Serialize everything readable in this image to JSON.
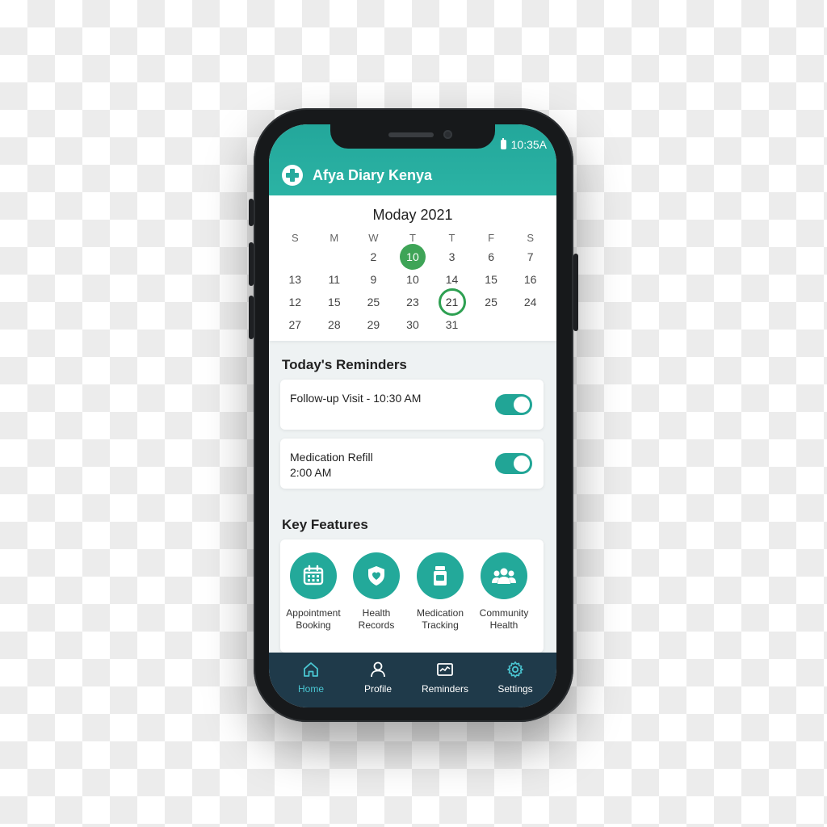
{
  "status_bar": {
    "time": "10:35A"
  },
  "app": {
    "title": "Afya Diary Kenya",
    "logo_icon": "medical-cross-icon"
  },
  "calendar": {
    "title": "Moday 2021",
    "weekdays": [
      "S",
      "M",
      "W",
      "T",
      "T",
      "F",
      "S"
    ],
    "weeks": [
      [
        "",
        "",
        "2",
        "10",
        "3",
        "6",
        "7"
      ],
      [
        "13",
        "11",
        "9",
        "10",
        "14",
        "15",
        "16"
      ],
      [
        "12",
        "15",
        "25",
        "23",
        "21",
        "25",
        "24"
      ],
      [
        "27",
        "28",
        "29",
        "30",
        "31",
        "",
        ""
      ]
    ],
    "highlighted_today": "10",
    "ringed_date": "21"
  },
  "reminders": {
    "title": "Today's Reminders",
    "items": [
      {
        "text": "Follow-up Visit - 10:30 AM",
        "enabled": true
      },
      {
        "line1": "Medication Refill",
        "line2": "2:00 AM",
        "enabled": true
      }
    ]
  },
  "features": {
    "title": "Key Features",
    "items": [
      {
        "line1": "Appointment",
        "line2": "Booking",
        "icon": "calendar-icon"
      },
      {
        "line1": "Health",
        "line2": "Records",
        "icon": "shield-heart-icon"
      },
      {
        "line1": "Medication",
        "line2": "Tracking",
        "icon": "medicine-bottle-icon"
      },
      {
        "line1": "Community",
        "line2": "Health",
        "icon": "group-icon"
      }
    ]
  },
  "nav": {
    "items": [
      {
        "label": "Home",
        "icon": "home-icon",
        "active": true
      },
      {
        "label": "Profile",
        "icon": "user-icon"
      },
      {
        "label": "Reminders",
        "icon": "reminder-icon"
      },
      {
        "label": "Settings",
        "icon": "gear-icon"
      }
    ]
  },
  "colors": {
    "accent": "#2bb3a4",
    "today": "#3ea457",
    "nav_bg": "#1f3a4a",
    "nav_active": "#4ac6d2"
  }
}
